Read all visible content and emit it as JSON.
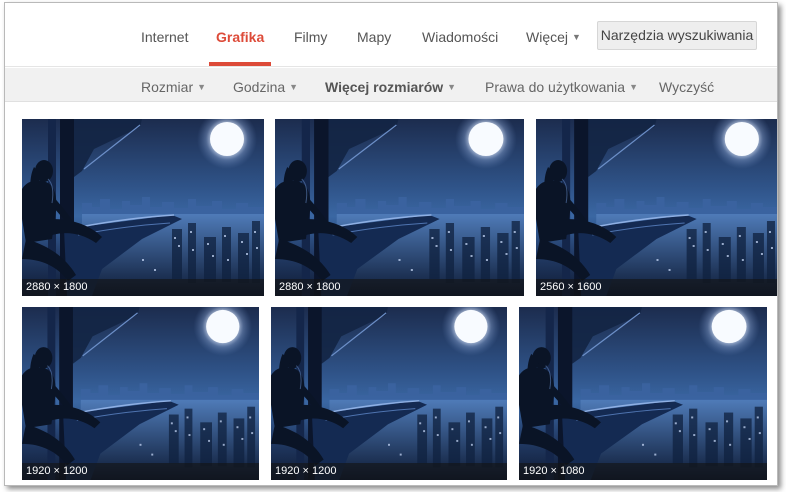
{
  "nav": {
    "tabs": [
      {
        "label": "Internet",
        "active": false
      },
      {
        "label": "Grafika",
        "active": true
      },
      {
        "label": "Filmy",
        "active": false
      },
      {
        "label": "Mapy",
        "active": false
      },
      {
        "label": "Wiadomości",
        "active": false
      },
      {
        "label": "Więcej",
        "active": false,
        "dropdown": true
      }
    ],
    "tools_button": "Narzędzia wyszukiwania"
  },
  "filters": [
    {
      "label": "Rozmiar",
      "dropdown": true
    },
    {
      "label": "Godzina",
      "dropdown": true
    },
    {
      "label": "Więcej rozmiarów",
      "dropdown": true,
      "bold": true
    },
    {
      "label": "Prawa do użytkowania",
      "dropdown": true
    },
    {
      "label": "Wyczyść",
      "dropdown": false
    }
  ],
  "results": [
    {
      "dimensions": "2880 × 1800"
    },
    {
      "dimensions": "2880 × 1800"
    },
    {
      "dimensions": "2560 × 1600"
    },
    {
      "dimensions": "1920 × 1200"
    },
    {
      "dimensions": "1920 × 1200"
    },
    {
      "dimensions": "1920 × 1080"
    }
  ],
  "colors": {
    "accent": "#dd4b39",
    "filter_bar": "#f1f1f1",
    "night_sky": "#2f5388",
    "moon": "#f4f8ff"
  }
}
